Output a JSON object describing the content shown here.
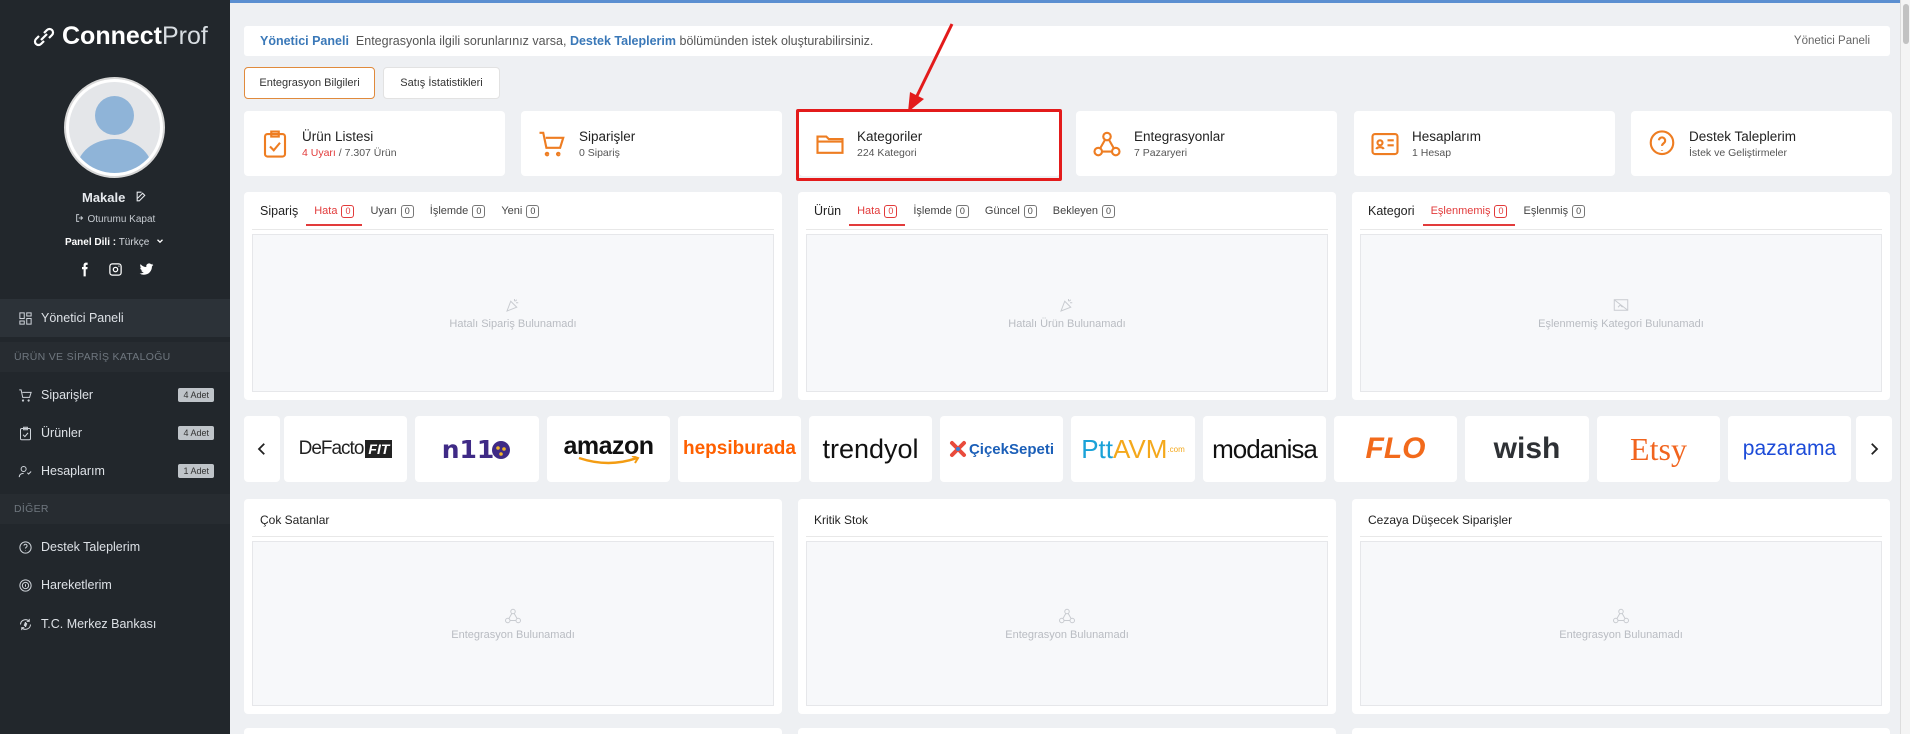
{
  "sidebar": {
    "logo_bold": "Connect",
    "logo_light": "Prof",
    "user_name": "Makale",
    "logout": "Oturumu Kapat",
    "lang_label": "Panel Dili :",
    "lang_value": "Türkçe",
    "nav": [
      {
        "label": "Yönetici Paneli"
      },
      {
        "label": "Siparişler",
        "badge": "4 Adet"
      },
      {
        "label": "Ürünler",
        "badge": "4 Adet"
      },
      {
        "label": "Hesaplarım",
        "badge": "1 Adet"
      },
      {
        "label": "Destek Taleplerim"
      },
      {
        "label": "Hareketlerim"
      },
      {
        "label": "T.C. Merkez Bankası"
      }
    ],
    "section1": "ÜRÜN VE SİPARİŞ KATALOĞU",
    "section2": "DİĞER"
  },
  "breadcrumb": {
    "title": "Yönetici Paneli",
    "text1": "Entegrasyonla ilgili sorunlarınız varsa,",
    "link": "Destek Taleplerim",
    "text2": "bölümünden istek oluşturabilirsiniz.",
    "right": "Yönetici Paneli"
  },
  "tabs": [
    "Entegrasyon Bilgileri",
    "Satış İstatistikleri"
  ],
  "cards": [
    {
      "title": "Ürün Listesi",
      "sub_red": "4 Uyarı",
      "sub": "/ 7.307 Ürün",
      "icon": "clipboard-icon"
    },
    {
      "title": "Siparişler",
      "sub": "0 Sipariş",
      "icon": "cart-icon"
    },
    {
      "title": "Kategoriler",
      "sub": "224 Kategori",
      "icon": "folder-icon"
    },
    {
      "title": "Entegrasyonlar",
      "sub": "7 Pazaryeri",
      "icon": "webhook-icon"
    },
    {
      "title": "Hesaplarım",
      "sub": "1 Hesap",
      "icon": "id-card-icon"
    },
    {
      "title": "Destek Taleplerim",
      "sub": "İstek ve Geliştirmeler",
      "icon": "help-icon"
    }
  ],
  "panels": [
    {
      "tabs": [
        {
          "l": "Sipariş"
        },
        {
          "l": "Hata",
          "c": "0"
        },
        {
          "l": "Uyarı",
          "c": "0"
        },
        {
          "l": "İşlemde",
          "c": "0"
        },
        {
          "l": "Yeni",
          "c": "0"
        }
      ],
      "empty": "Hatalı Sipariş Bulunamadı"
    },
    {
      "tabs": [
        {
          "l": "Ürün"
        },
        {
          "l": "Hata",
          "c": "0"
        },
        {
          "l": "İşlemde",
          "c": "0"
        },
        {
          "l": "Güncel",
          "c": "0"
        },
        {
          "l": "Bekleyen",
          "c": "0"
        }
      ],
      "empty": "Hatalı Ürün Bulunamadı"
    },
    {
      "tabs": [
        {
          "l": "Kategori"
        },
        {
          "l": "Eşlenmemiş",
          "c": "0"
        },
        {
          "l": "Eşlenmiş",
          "c": "0"
        }
      ],
      "empty": "Eşlenmemiş Kategori Bulunamadı"
    }
  ],
  "brands": [
    "DeFacto",
    "FIT",
    "n11",
    "amazon",
    "hepsiburada",
    "trendyol",
    "ÇiçekSepeti",
    "Ptt",
    "AVM",
    ".com",
    "modanisa",
    "FLO",
    "wish",
    "Etsy",
    "pazarama"
  ],
  "bottom_panels": [
    {
      "title": "Çok Satanlar",
      "empty": "Entegrasyon Bulunamadı"
    },
    {
      "title": "Kritik Stok",
      "empty": "Entegrasyon Bulunamadı"
    },
    {
      "title": "Cezaya Düşecek Siparişler",
      "empty": "Entegrasyon Bulunamadı"
    }
  ],
  "colors": {
    "accent": "#ee7d22",
    "highlight": "#e31b1b",
    "sidebar": "#22272c",
    "link": "#3a78b8"
  }
}
